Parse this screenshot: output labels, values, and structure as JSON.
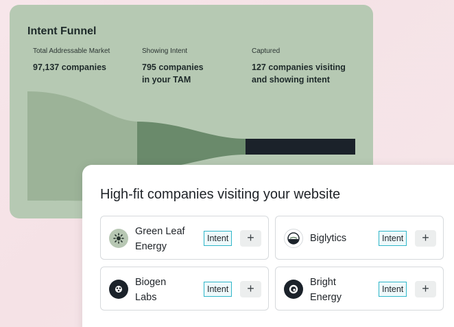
{
  "funnel": {
    "title": "Intent Funnel",
    "stages": [
      {
        "label": "Total Addressable Market",
        "value_line1": "97,137 companies",
        "value_line2": ""
      },
      {
        "label": "Showing Intent",
        "value_line1": "795 companies",
        "value_line2": "in your TAM"
      },
      {
        "label": "Captured",
        "value_line1": "127 companies visiting",
        "value_line2": "and showing intent"
      }
    ],
    "colors": {
      "card": "#b6c9b3",
      "stage_tam": "#9cb398",
      "stage_intent": "#6a8a6b",
      "stage_captured": "#1b222a"
    }
  },
  "high_fit": {
    "title": "High-fit companies visiting your website",
    "intent_label": "Intent",
    "add_label": "+",
    "companies": [
      {
        "name_line1": "Green Leaf",
        "name_line2": "Energy",
        "logo_icon": "sun-icon"
      },
      {
        "name_line1": "Biglytics",
        "name_line2": "",
        "logo_icon": "half-circle-icon"
      },
      {
        "name_line1": "Biogen",
        "name_line2": "Labs",
        "logo_icon": "dots-icon"
      },
      {
        "name_line1": "Bright",
        "name_line2": "Energy",
        "logo_icon": "ring-icon"
      }
    ]
  }
}
